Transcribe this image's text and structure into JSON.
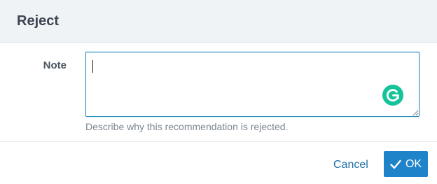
{
  "dialog": {
    "title": "Reject"
  },
  "form": {
    "note_label": "Note",
    "note_value": "",
    "note_help": "Describe why this recommendation is rejected."
  },
  "footer": {
    "cancel_label": "Cancel",
    "ok_label": "OK"
  },
  "colors": {
    "header_bg": "#f0f3f6",
    "primary": "#1f83c9",
    "link": "#1d6fa5",
    "grammarly": "#15c39a"
  },
  "icons": {
    "ok": "check-icon",
    "extension": "grammarly-icon"
  }
}
